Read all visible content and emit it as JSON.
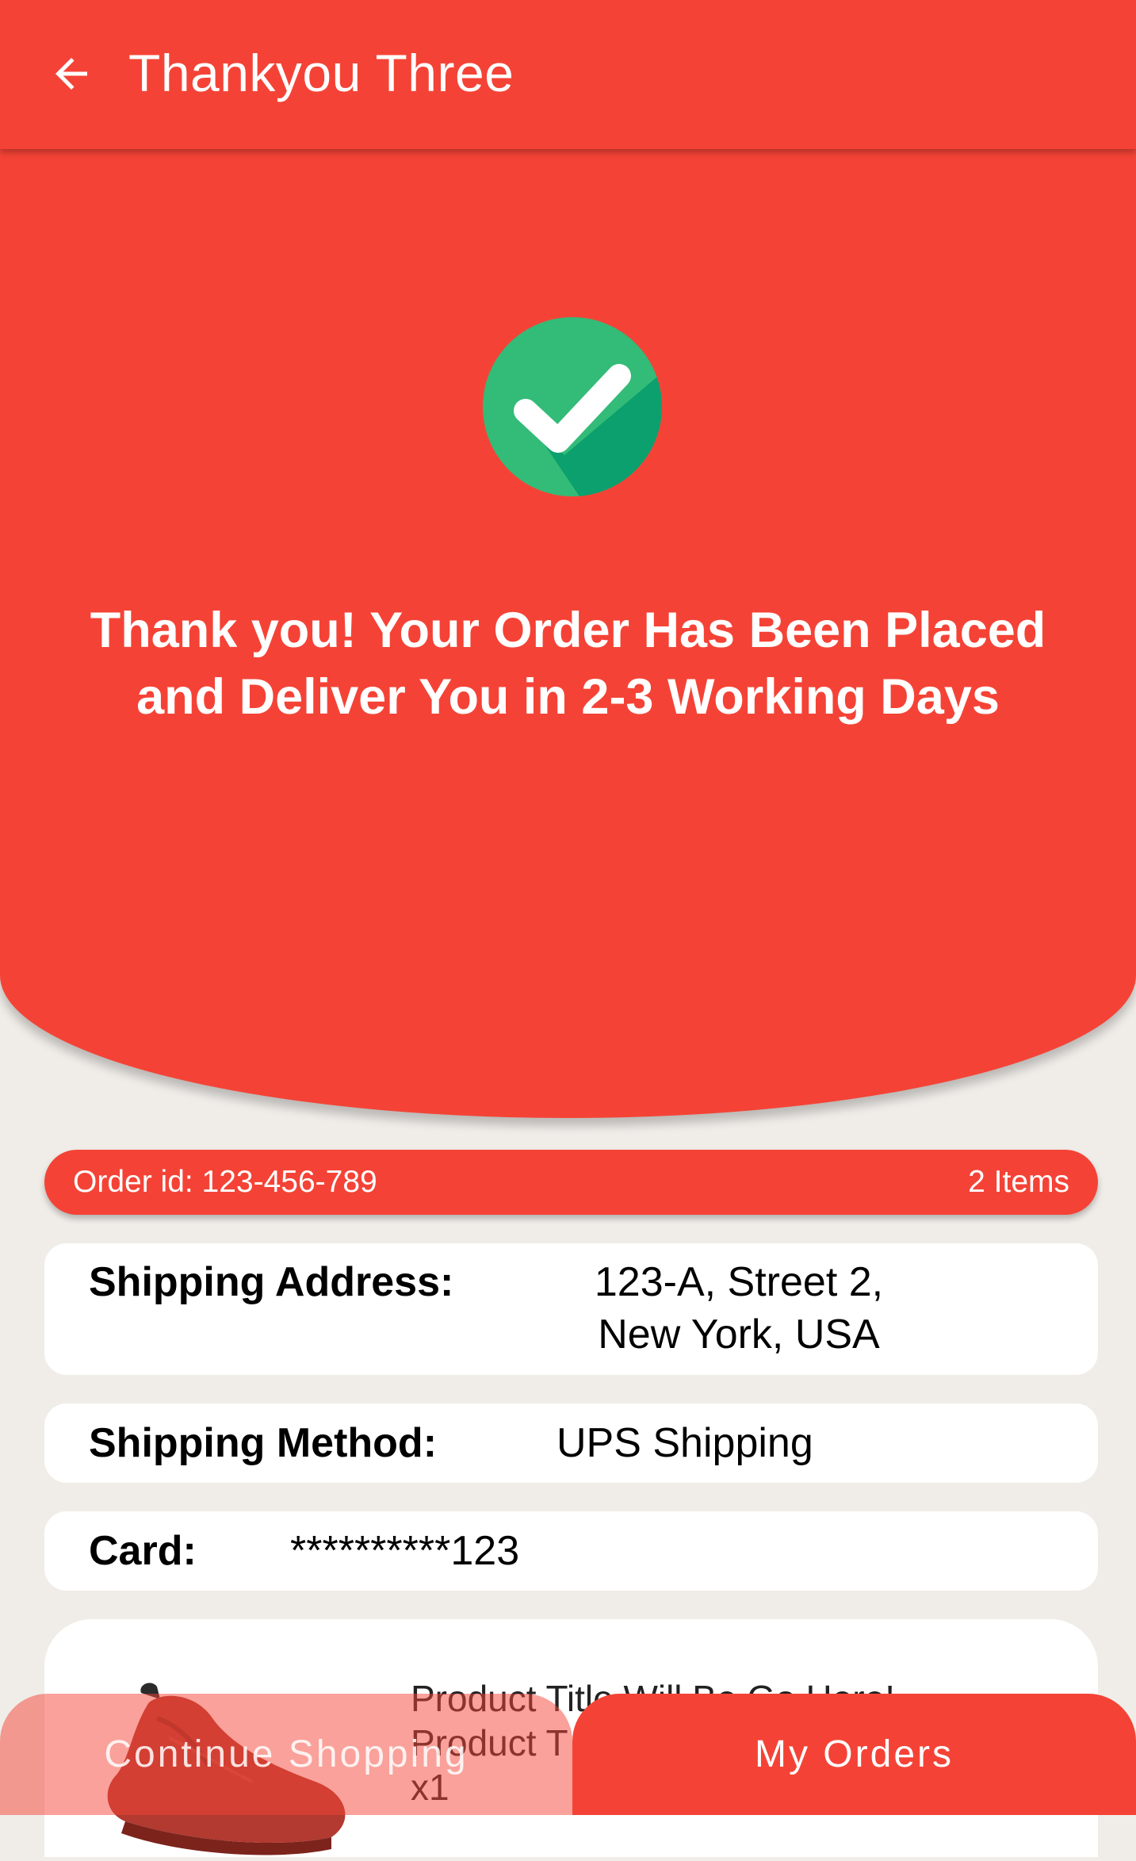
{
  "app_bar": {
    "title": "Thankyou Three",
    "back_icon": "arrow-left-icon"
  },
  "colors": {
    "primary": "#f44336",
    "background": "#f0ede9",
    "success_green": "#33bb78",
    "success_green_shadow": "#0ba06d"
  },
  "hero": {
    "icon": "check-circle-icon",
    "message": "Thank you! Your Order Has Been Placed and Deliver You in 2-3 Working Days"
  },
  "order": {
    "id_text": "Order id: 123-456-789",
    "items_text": "2 Items"
  },
  "shipping_address": {
    "label": "Shipping Address:",
    "line1": "123-A, Street 2,",
    "line2": "New York, USA"
  },
  "shipping_method": {
    "label": "Shipping Method:",
    "value": "UPS Shipping"
  },
  "card": {
    "label": "Card:",
    "value": "**********123"
  },
  "product": {
    "image_icon": "shoe-image",
    "title": "Product Title Will Be Go Here!",
    "subtitle": "Product T",
    "qty": "x1"
  },
  "buttons": {
    "continue_shopping": "Continue Shopping",
    "my_orders": "My Orders"
  }
}
